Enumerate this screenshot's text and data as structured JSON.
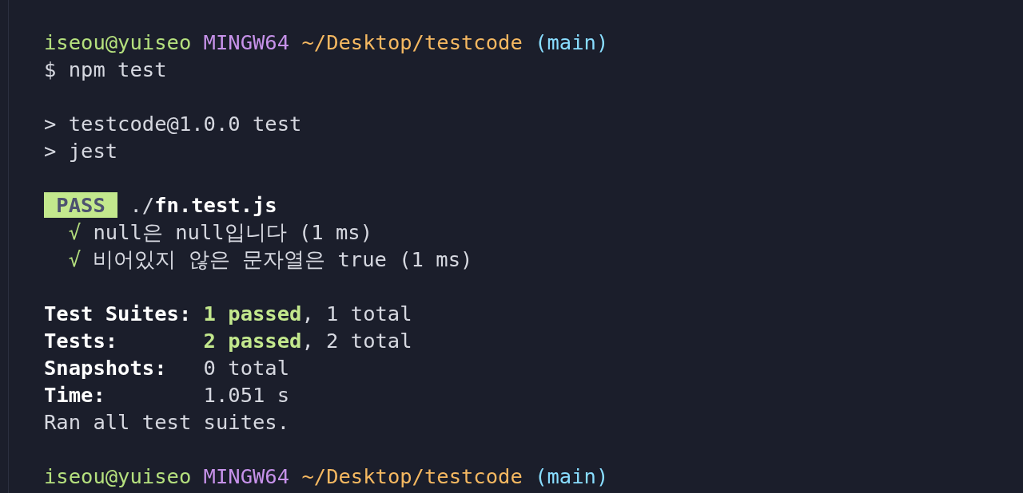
{
  "terminal": {
    "lines": [
      {
        "kind": "text",
        "segments": [
          {
            "kind": "user",
            "text": "iseou@yuiseo"
          },
          {
            "kind": "host",
            "text": "MINGW64"
          },
          {
            "kind": "path",
            "text": "~/Desktop/testcode"
          },
          {
            "kind": "branch",
            "text": "(main)"
          }
        ]
      },
      {
        "kind": "text",
        "segments": [
          {
            "kind": "command",
            "text": "$ npm test"
          }
        ]
      },
      {
        "kind": "blank"
      },
      {
        "kind": "text",
        "segments": [
          {
            "kind": "output",
            "text": "> testcode@1.0.0 test"
          }
        ]
      },
      {
        "kind": "text",
        "segments": [
          {
            "kind": "output",
            "text": "> jest"
          }
        ]
      },
      {
        "kind": "blank"
      },
      {
        "kind": "text",
        "segments": [
          {
            "kind": "badge",
            "text": "PASS"
          },
          {
            "kind": "output",
            "text": "./"
          },
          {
            "kind": "file",
            "text": "fn.test.js"
          }
        ]
      },
      {
        "kind": "text",
        "segments": [
          {
            "kind": "check",
            "text": "√"
          },
          {
            "kind": "output",
            "text": "null은 null입니다 (1 ms)"
          }
        ]
      },
      {
        "kind": "text",
        "segments": [
          {
            "kind": "check",
            "text": "√"
          },
          {
            "kind": "output",
            "text": "비어있지 않은 문자열은 true (1 ms)"
          }
        ]
      },
      {
        "kind": "blank"
      },
      {
        "kind": "text",
        "segments": [
          {
            "kind": "label",
            "text": "Test Suites:"
          },
          {
            "kind": "passed",
            "text": "1 passed"
          },
          {
            "kind": "tail",
            "text": ", 1 total"
          }
        ]
      },
      {
        "kind": "text",
        "segments": [
          {
            "kind": "label",
            "text": "Tests:"
          },
          {
            "kind": "passed",
            "text": "2 passed"
          },
          {
            "kind": "tail",
            "text": ", 2 total"
          }
        ]
      },
      {
        "kind": "text",
        "segments": [
          {
            "kind": "label",
            "text": "Snapshots:"
          },
          {
            "kind": "output",
            "text": "0 total"
          }
        ]
      },
      {
        "kind": "text",
        "segments": [
          {
            "kind": "label",
            "text": "Time:"
          },
          {
            "kind": "output",
            "text": "1.051 s"
          }
        ]
      },
      {
        "kind": "text",
        "segments": [
          {
            "kind": "output",
            "text": "Ran all test suites."
          }
        ]
      },
      {
        "kind": "blank"
      },
      {
        "kind": "text",
        "segments": [
          {
            "kind": "user",
            "text": "iseou@yuiseo"
          },
          {
            "kind": "host",
            "text": "MINGW64"
          },
          {
            "kind": "path",
            "text": "~/Desktop/testcode"
          },
          {
            "kind": "branch",
            "text": "(main)"
          }
        ]
      }
    ]
  }
}
